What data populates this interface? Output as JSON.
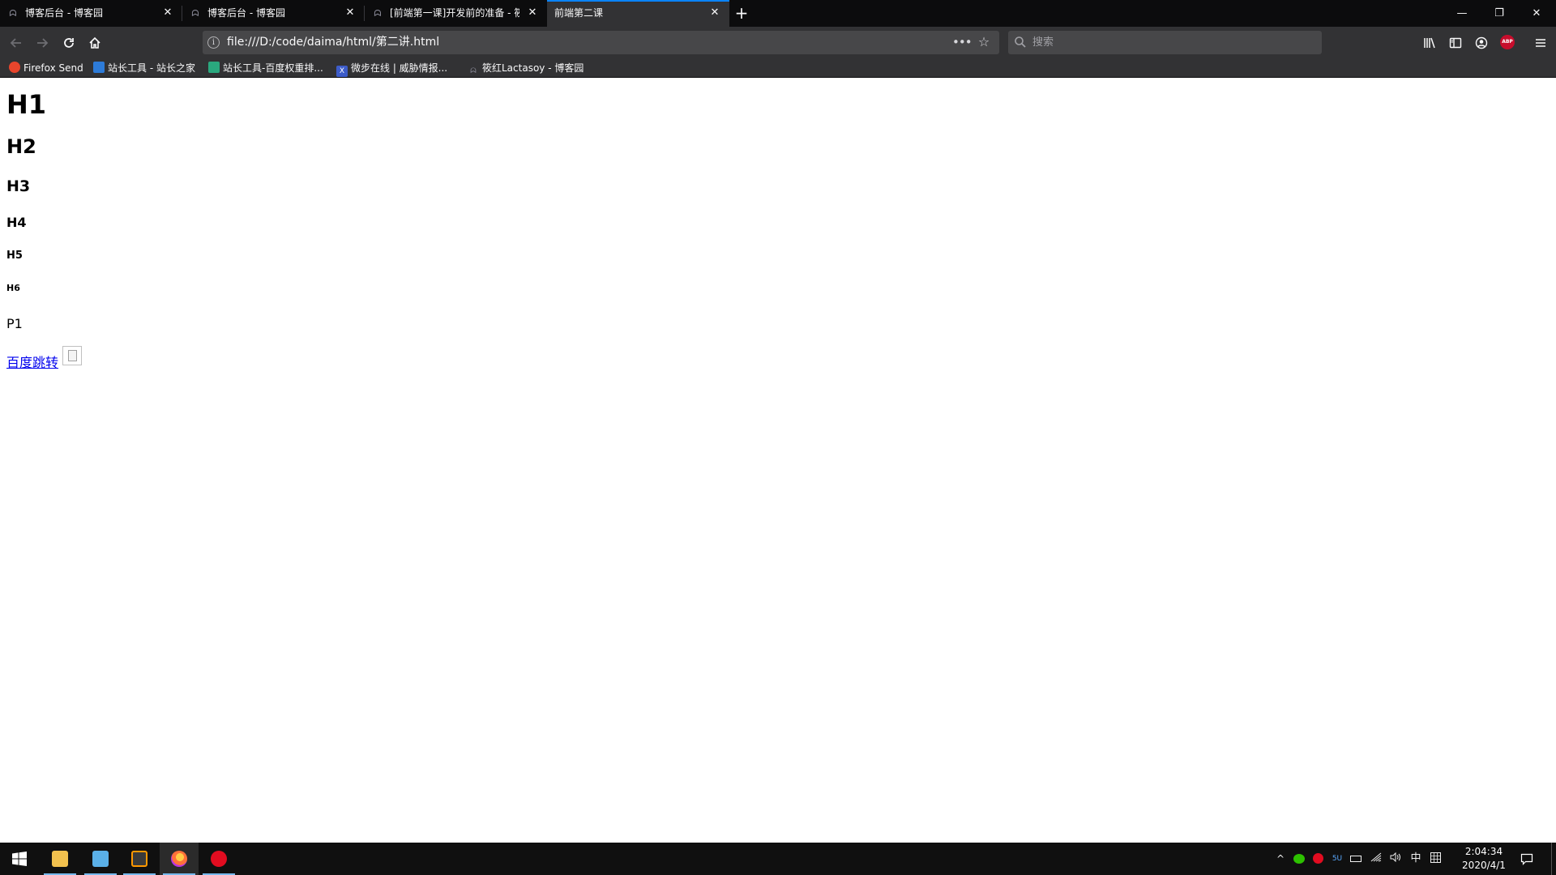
{
  "tabs": [
    {
      "title": "博客后台 - 博客园",
      "close_icon": "close-icon"
    },
    {
      "title": "博客后台 - 博客园",
      "close_icon": "close-icon"
    },
    {
      "title": "[前端第一课]开发前的准备 - 筱",
      "close_icon": "close-icon"
    },
    {
      "title": "前端第二课",
      "close_icon": "close-icon",
      "active": true
    }
  ],
  "navbar": {
    "url": "file:///D:/code/daima/html/第二讲.html",
    "search_placeholder": "搜索",
    "abp_label": "ABP"
  },
  "bookmarks": [
    {
      "label": "Firefox Send",
      "icon": "firefox-send-icon"
    },
    {
      "label": "站长工具 - 站长之家",
      "icon": "chinaz-icon"
    },
    {
      "label": "站长工具-百度权重排...",
      "icon": "chinaz-rank-icon"
    },
    {
      "label": "微步在线 | 威胁情报...",
      "icon": "threatbook-icon"
    },
    {
      "label": "筱红Lactasoy - 博客园",
      "icon": "cnblogs-icon"
    }
  ],
  "page": {
    "h1": "H1",
    "h2": "H2",
    "h3": "H3",
    "h4": "H4",
    "h5": "H5",
    "h6": "H6",
    "p1": "P1",
    "link": "百度跳转"
  },
  "taskbar": {
    "apps": [
      "file-explorer-icon",
      "finder-icon",
      "sublime-text-icon",
      "firefox-icon",
      "netease-music-icon"
    ],
    "tray": {
      "ime": "中",
      "time": "2:04:34",
      "date": "2020/4/1"
    }
  },
  "colors": {
    "tab_active_accent": "#0a84ff",
    "toolbar_bg": "#323234",
    "tabstrip_bg": "#0c0c0d",
    "link": "#0000ee",
    "taskbar_bg": "#101010"
  }
}
